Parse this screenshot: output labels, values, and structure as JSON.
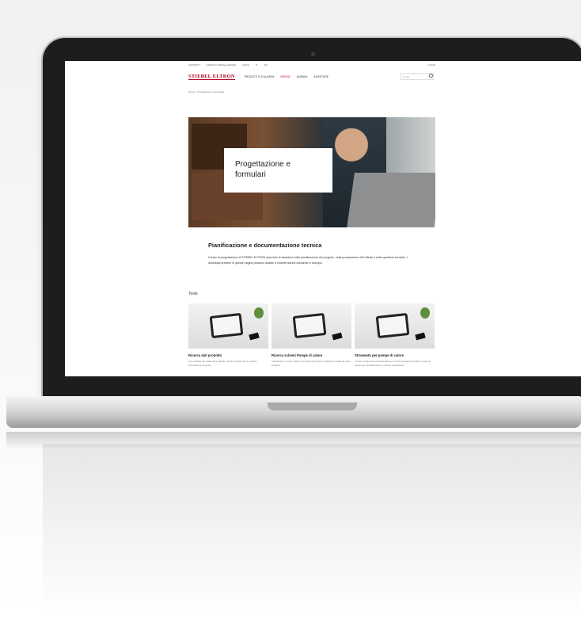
{
  "topbar": {
    "links": [
      "CONTATTI",
      "CORSI DI INSTALLAZIONE",
      "AIUTO",
      "IT",
      "FR"
    ],
    "login": "LOGIN"
  },
  "header": {
    "logo": "STIEBEL ELTRON",
    "nav": [
      "PRODOTTI E SOLUZIONI",
      "SERVIZI",
      "AZIENDA",
      "INVESTORE"
    ],
    "active_nav": 1,
    "search_placeholder": "Cerca"
  },
  "breadcrumb": "Home > Progettazione e formulari",
  "hero": {
    "title": "Progettazione e formulari"
  },
  "intro": {
    "title": "Pianificazione e documentazione tecnica",
    "text": "Il team di progettazione di STIEBEL ELTRON sarà lieto di assistervi nella pianificazione del progetto, nella preparazione dell’offerta e nelle questioni tecniche. I download presenti in queste pagine possono aiutare a chiarire alcune domande in anticipo."
  },
  "tools": {
    "title": "Tools",
    "cards": [
      {
        "title": "Ricerca dati prodotto",
        "text": "Con l’ausilio dei codici del prodotto, potete trovare tutte le relative informazioni tecniche."
      },
      {
        "title": "Ricerca schemi Pompe di calore",
        "text": "Individuare in modo rapido e semplice gli schemi idraulici più adatti ai vostri impianti."
      },
      {
        "title": "Strumento per pompe di calore",
        "text": "Il nostro strumento professionale per il dimensionamento delle pompe di calore per riscaldamento e unità di ventilazione."
      }
    ]
  },
  "colors": {
    "brand": "#b1001c",
    "active": "#c4002a"
  }
}
